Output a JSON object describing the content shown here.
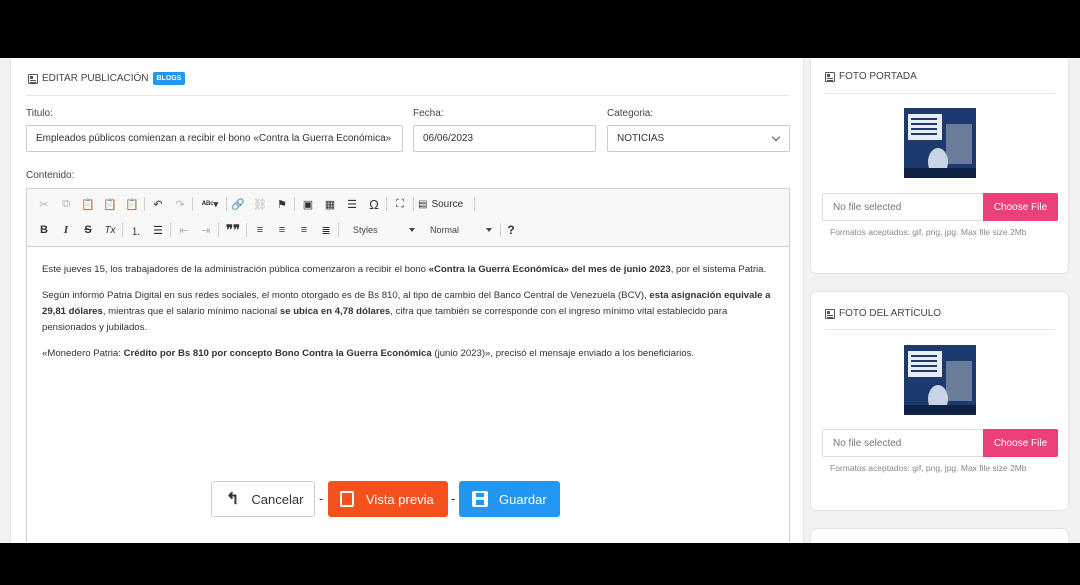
{
  "form": {
    "header_title": "EDITAR PUBLICACIÓN",
    "header_badge": "BLOGS",
    "title_label": "Titulo:",
    "title_value": "Empleados públicos comienzan a recibir el bono «Contra la Guerra Económica»",
    "date_label": "Fecha:",
    "date_value": "06/06/2023",
    "category_label": "Categoria:",
    "category_value": "NOTICIAS",
    "content_label": "Contenido:"
  },
  "toolbar": {
    "row1": [
      "cut-icon",
      "copy-icon",
      "paste-icon",
      "paste-text-icon",
      "paste-word-icon",
      "undo-icon",
      "redo-icon",
      "spellcheck-icon",
      "link-icon",
      "unlink-icon",
      "anchor-icon",
      "image-icon",
      "table-icon",
      "horizontal-line-icon",
      "special-char-icon",
      "maximize-icon",
      "source-icon"
    ],
    "source_label": "Source",
    "styles_label": "Styles",
    "format_label": "Normal",
    "bold": "B",
    "italic": "I",
    "strike": "S",
    "clear_format": "Tx",
    "quote": "99",
    "help": "?"
  },
  "content": {
    "p1_a": "Este jueves 15, los trabajadores de la administración pública comenzaron a recibir el bono ",
    "p1_b": "«Contra la Guerra Económica» del mes de junio 2023",
    "p1_c": ", por el sistema Patria.",
    "p2_a": "Según informó Patria Digital en sus redes sociales, el monto otorgado es de Bs 810, al tipo de cambio del Banco Central de Venezuela (BCV), ",
    "p2_b": "esta asignación equivale a 29,81 dólares",
    "p2_c": ", mientras que el salario mínimo nacional ",
    "p2_d": "se ubica en 4,78 dólares",
    "p2_e": ", cifra que también se corresponde con el ingreso mínimo vital establecido para pensionados y jubilados.",
    "p3_a": "«Monedero Patria: ",
    "p3_b": "Crédito por Bs 810 por concepto Bono Contra la Guerra Económica",
    "p3_c": " (junio 2023)», precisó el mensaje enviado a los beneficiarios."
  },
  "actions": {
    "cancel": "Cancelar",
    "preview": "Vista previa",
    "save": "Guardar",
    "separator": "-"
  },
  "sidebar": {
    "cover": {
      "title": "FOTO PORTADA",
      "file_placeholder": "No file selected",
      "choose_label": "Choose File",
      "hint": "Formatos aceptados: gif, png, jpg. Max file size 2Mb"
    },
    "article": {
      "title": "FOTO DEL ARTÍCULO",
      "file_placeholder": "No file selected",
      "choose_label": "Choose File",
      "hint": "Formatos aceptados: gif, png, jpg. Max file size 2Mb"
    }
  },
  "colors": {
    "badge": "#2196f3",
    "preview_button": "#f4511e",
    "save_button": "#2196f3",
    "choose_file": "#ec407a"
  }
}
